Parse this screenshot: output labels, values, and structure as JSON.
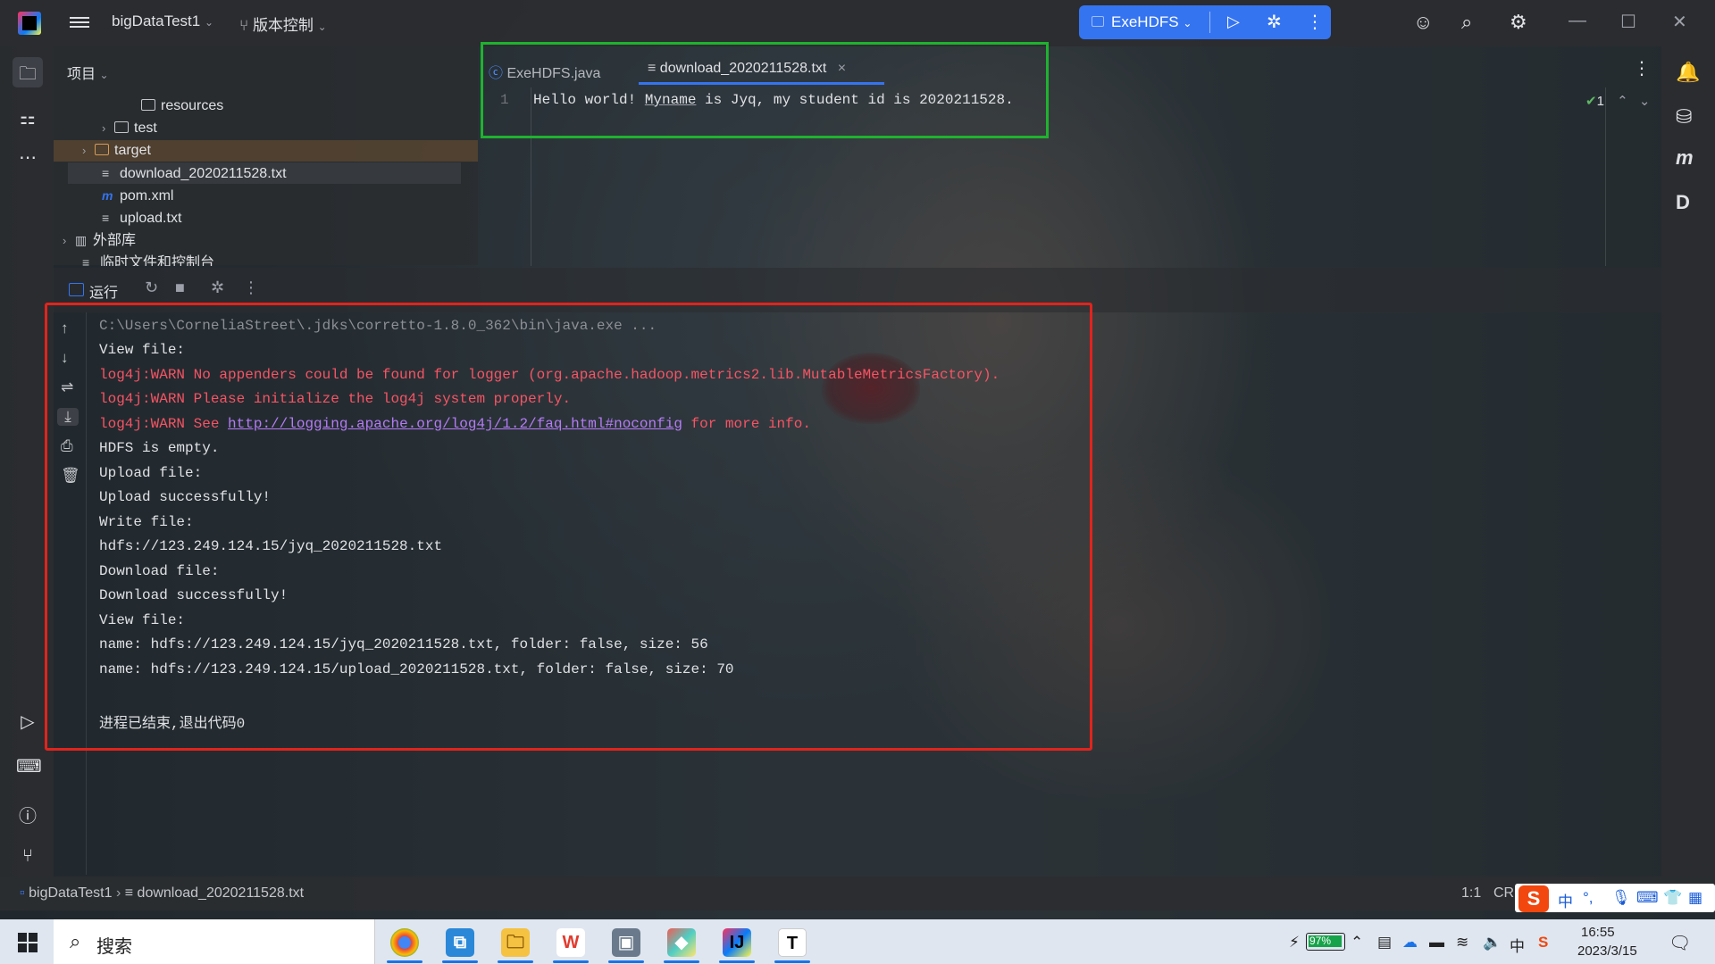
{
  "titlebar": {
    "project_name": "bigDataTest1",
    "vcs_label": "版本控制",
    "run_config": "ExeHDFS"
  },
  "project_panel": {
    "header": "项目",
    "items": [
      {
        "label": "resources",
        "kind": "folder"
      },
      {
        "label": "test",
        "kind": "folder"
      },
      {
        "label": "target",
        "kind": "folder"
      },
      {
        "label": "download_2020211528.txt",
        "kind": "text-file"
      },
      {
        "label": "pom.xml",
        "kind": "maven-file"
      },
      {
        "label": "upload.txt",
        "kind": "text-file"
      },
      {
        "label": "外部库",
        "kind": "library"
      },
      {
        "label": "临时文件和控制台",
        "kind": "scratch"
      }
    ]
  },
  "editor": {
    "tabs": [
      {
        "label": "ExeHDFS.java",
        "active": false
      },
      {
        "label": "download_2020211528.txt",
        "active": true
      }
    ],
    "line_number": "1",
    "code_before": "Hello world! ",
    "code_typo": "Myname",
    "code_after": " is Jyq, my student id is 2020211528.",
    "inspection_count": "1"
  },
  "run_panel": {
    "title": "运行",
    "console": [
      {
        "text": "C:\\Users\\CorneliaStreet\\.jdks\\corretto-1.8.0_362\\bin\\java.exe ...",
        "style": "gray"
      },
      {
        "text": "View file:",
        "style": "normal"
      },
      {
        "text": "log4j:WARN No appenders could be found for logger (org.apache.hadoop.metrics2.lib.MutableMetricsFactory).",
        "style": "red"
      },
      {
        "text": "log4j:WARN Please initialize the log4j system properly.",
        "style": "red"
      },
      {
        "text": "HDFS is empty.",
        "style": "normal"
      },
      {
        "text": "Upload file:",
        "style": "normal"
      },
      {
        "text": "Upload successfully!",
        "style": "normal"
      },
      {
        "text": "Write file:",
        "style": "normal"
      },
      {
        "text": "hdfs://123.249.124.15/jyq_2020211528.txt",
        "style": "normal"
      },
      {
        "text": "Download file:",
        "style": "normal"
      },
      {
        "text": "Download successfully!",
        "style": "normal"
      },
      {
        "text": "View file:",
        "style": "normal"
      },
      {
        "text": "name: hdfs://123.249.124.15/jyq_2020211528.txt, folder: false, size: 56",
        "style": "normal"
      },
      {
        "text": "name: hdfs://123.249.124.15/upload_2020211528.txt, folder: false, size: 70",
        "style": "normal"
      },
      {
        "text": "进程已结束,退出代码0",
        "style": "normal"
      }
    ],
    "warn_link_prefix": "log4j:WARN See ",
    "warn_link": "http://logging.apache.org/log4j/1.2/faq.html#noconfig",
    "warn_link_suffix": " for more info."
  },
  "status_bar": {
    "breadcrumb_project": "bigDataTest1",
    "breadcrumb_file": "download_2020211528.txt",
    "position": "1:1",
    "line_sep": "CRLF"
  },
  "ime": {
    "mode": "中",
    "punct": "°,"
  },
  "taskbar": {
    "search_placeholder": "搜索",
    "battery": "97%",
    "battery_level": 0.97,
    "time": "16:55",
    "date": "2023/3/15",
    "input_lang": "中"
  },
  "colors": {
    "accent": "#3574f0",
    "green_box": "#1fb22f",
    "red_box": "#e0241d",
    "warn_text": "#f75464",
    "link_text": "#b57bf5"
  }
}
